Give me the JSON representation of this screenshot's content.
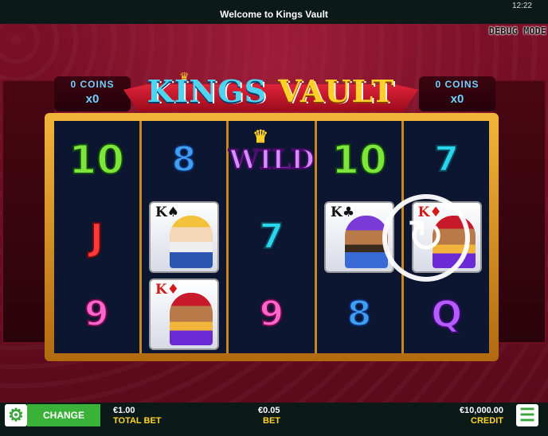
{
  "topbar": {
    "title": "Welcome to Kings Vault",
    "clock": "12:22"
  },
  "debug_label": "DEBUG MODE",
  "logo": {
    "word1": "KINGS",
    "word2": "VAULT"
  },
  "coins_left": {
    "label": "0 COINS",
    "multiplier": "x0"
  },
  "coins_right": {
    "label": "0 COINS",
    "multiplier": "x0"
  },
  "reels": [
    {
      "symbols": [
        "10",
        "J",
        "9"
      ]
    },
    {
      "symbols": [
        "8",
        "K♠",
        "K♦"
      ]
    },
    {
      "symbols": [
        "WILD",
        "7",
        "9"
      ]
    },
    {
      "symbols": [
        "10",
        "K♣",
        "8"
      ]
    },
    {
      "symbols": [
        "7",
        "K♦",
        "Q"
      ]
    }
  ],
  "icons": {
    "spin": "spin-arrow-icon",
    "settings": "gear-icon",
    "menu": "hamburger-menu-icon"
  },
  "bottom": {
    "change_label": "CHANGE",
    "total_bet_value": "€1.00",
    "total_bet_label": "TOTAL BET",
    "bet_value": "€0.05",
    "bet_label": "BET",
    "credit_value": "€10,000.00",
    "credit_label": "CREDIT"
  },
  "colors": {
    "accent_green": "#3ab23a",
    "label_yellow": "#ffd42a",
    "coins_blue": "#6fd3ff"
  }
}
